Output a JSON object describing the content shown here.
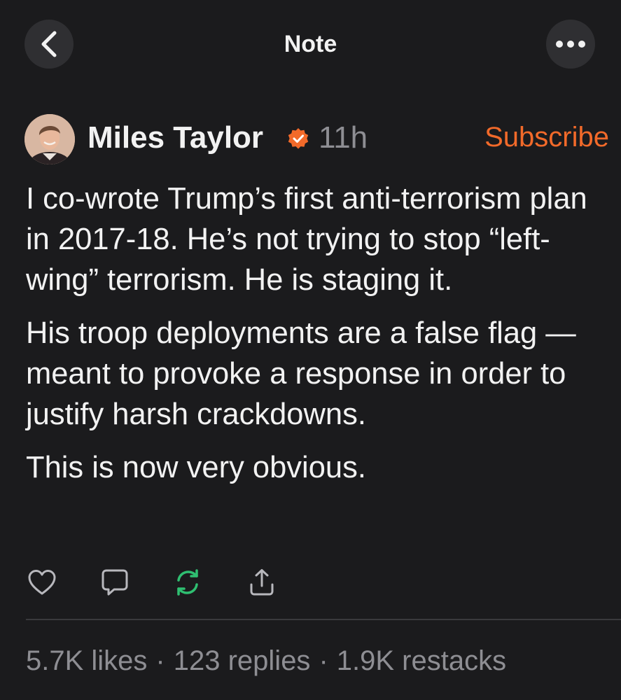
{
  "nav": {
    "title": "Note",
    "back_icon": "chevron-left-icon",
    "more_icon": "ellipsis-icon"
  },
  "post": {
    "author": "Miles Taylor",
    "verified_icon": "verified-badge-icon",
    "time": "11h",
    "subscribe_label": "Subscribe",
    "paragraphs": [
      "I co-wrote Trump’s first anti-terrorism plan in 2017-18. He’s not trying to stop “left-wing” terrorism. He is staging it.",
      "His troop deployments are a false flag — meant to provoke a response in order to justify harsh crackdowns.",
      "This is now very obvious."
    ]
  },
  "actions": {
    "like_icon": "heart-icon",
    "reply_icon": "comment-icon",
    "restack_icon": "restack-icon",
    "share_icon": "share-icon"
  },
  "stats": {
    "likes": "5.7K likes",
    "replies": "123 replies",
    "restacks": "1.9K restacks",
    "separator": "·"
  },
  "colors": {
    "background": "#1b1b1d",
    "accent": "#f26a2a",
    "restack": "#2fbf71",
    "muted": "#8e8e93"
  }
}
